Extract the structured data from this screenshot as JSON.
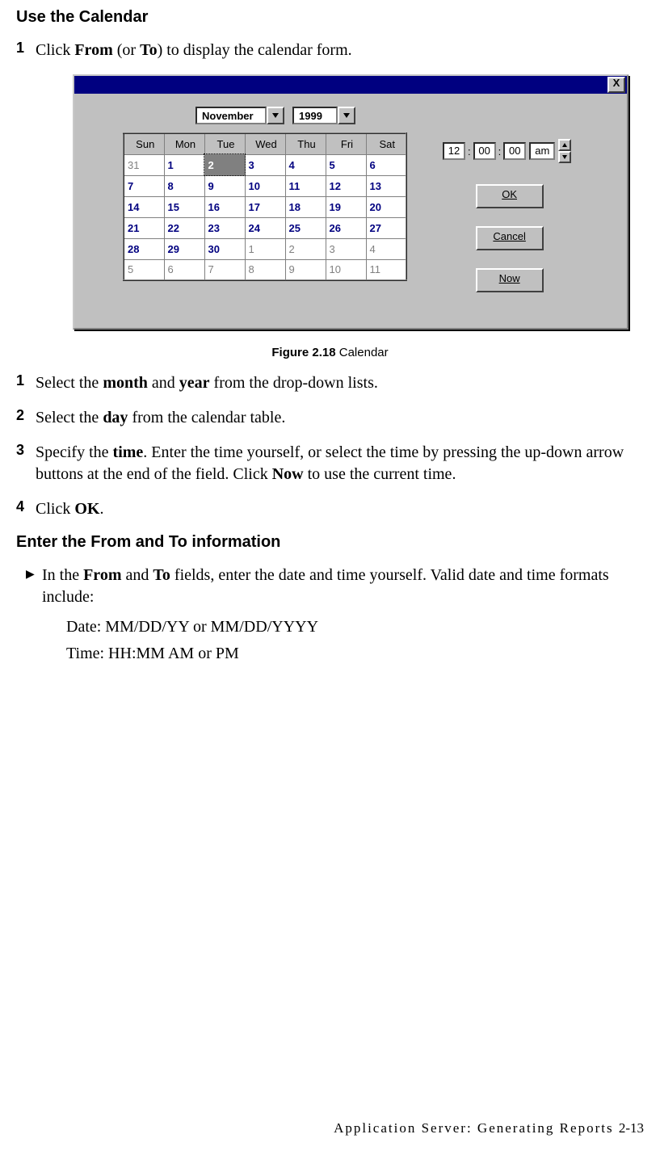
{
  "section1_title": "Use the Calendar",
  "step_from_to": {
    "num": "1",
    "pre": "Click ",
    "b1": "From",
    "mid": " (or ",
    "b2": "To",
    "post": ") to display the calendar form."
  },
  "calendar": {
    "month": "November",
    "year": "1999",
    "headers": [
      "Sun",
      "Mon",
      "Tue",
      "Wed",
      "Thu",
      "Fri",
      "Sat"
    ],
    "rows": [
      [
        {
          "v": "31",
          "cls": "dim"
        },
        {
          "v": "1",
          "cls": "cur"
        },
        {
          "v": "2",
          "cls": "sel"
        },
        {
          "v": "3",
          "cls": "cur"
        },
        {
          "v": "4",
          "cls": "cur"
        },
        {
          "v": "5",
          "cls": "cur"
        },
        {
          "v": "6",
          "cls": "cur"
        }
      ],
      [
        {
          "v": "7",
          "cls": "cur"
        },
        {
          "v": "8",
          "cls": "cur"
        },
        {
          "v": "9",
          "cls": "cur"
        },
        {
          "v": "10",
          "cls": "cur"
        },
        {
          "v": "11",
          "cls": "cur"
        },
        {
          "v": "12",
          "cls": "cur"
        },
        {
          "v": "13",
          "cls": "cur"
        }
      ],
      [
        {
          "v": "14",
          "cls": "cur"
        },
        {
          "v": "15",
          "cls": "cur"
        },
        {
          "v": "16",
          "cls": "cur"
        },
        {
          "v": "17",
          "cls": "cur"
        },
        {
          "v": "18",
          "cls": "cur"
        },
        {
          "v": "19",
          "cls": "cur"
        },
        {
          "v": "20",
          "cls": "cur"
        }
      ],
      [
        {
          "v": "21",
          "cls": "cur"
        },
        {
          "v": "22",
          "cls": "cur"
        },
        {
          "v": "23",
          "cls": "cur"
        },
        {
          "v": "24",
          "cls": "cur"
        },
        {
          "v": "25",
          "cls": "cur"
        },
        {
          "v": "26",
          "cls": "cur"
        },
        {
          "v": "27",
          "cls": "cur"
        }
      ],
      [
        {
          "v": "28",
          "cls": "cur"
        },
        {
          "v": "29",
          "cls": "cur"
        },
        {
          "v": "30",
          "cls": "cur"
        },
        {
          "v": "1",
          "cls": "dim"
        },
        {
          "v": "2",
          "cls": "dim"
        },
        {
          "v": "3",
          "cls": "dim"
        },
        {
          "v": "4",
          "cls": "dim"
        }
      ],
      [
        {
          "v": "5",
          "cls": "dim"
        },
        {
          "v": "6",
          "cls": "dim"
        },
        {
          "v": "7",
          "cls": "dim"
        },
        {
          "v": "8",
          "cls": "dim"
        },
        {
          "v": "9",
          "cls": "dim"
        },
        {
          "v": "10",
          "cls": "dim"
        },
        {
          "v": "11",
          "cls": "dim"
        }
      ]
    ],
    "time": {
      "hh": "12",
      "mm": "00",
      "ss": "00",
      "ampm": "am"
    },
    "buttons": {
      "ok": "OK",
      "cancel": "Cancel",
      "now": "Now"
    },
    "close": "X"
  },
  "figure_caption": {
    "bold": "Figure 2.18",
    "rest": " Calendar"
  },
  "steps2": [
    {
      "num": "1",
      "parts": [
        {
          "t": "Select the "
        },
        {
          "t": "month",
          "b": true
        },
        {
          "t": " and "
        },
        {
          "t": "year",
          "b": true
        },
        {
          "t": " from the drop-down lists."
        }
      ]
    },
    {
      "num": "2",
      "parts": [
        {
          "t": "Select the "
        },
        {
          "t": "day",
          "b": true
        },
        {
          "t": " from the calendar table."
        }
      ]
    },
    {
      "num": "3",
      "parts": [
        {
          "t": "Specify the "
        },
        {
          "t": "time",
          "b": true
        },
        {
          "t": ". Enter the time yourself, or select the time by pressing the up-down arrow buttons at the end of the field. Click "
        },
        {
          "t": "Now",
          "b": true
        },
        {
          "t": " to use the current time."
        }
      ]
    },
    {
      "num": "4",
      "parts": [
        {
          "t": "Click "
        },
        {
          "t": "OK",
          "b": true
        },
        {
          "t": "."
        }
      ]
    }
  ],
  "section2_title": "Enter the From and To information",
  "bullet": {
    "parts": [
      {
        "t": "In the "
      },
      {
        "t": "From",
        "b": true
      },
      {
        "t": " and "
      },
      {
        "t": "To",
        "b": true
      },
      {
        "t": " fields, enter the date and time yourself. Valid date and time formats include:"
      }
    ]
  },
  "formats": {
    "date": "Date: MM/DD/YY or MM/DD/YYYY",
    "time": "Time: HH:MM AM or PM"
  },
  "footer": {
    "text": "Application Server: Generating Reports",
    "page": "2-13"
  }
}
